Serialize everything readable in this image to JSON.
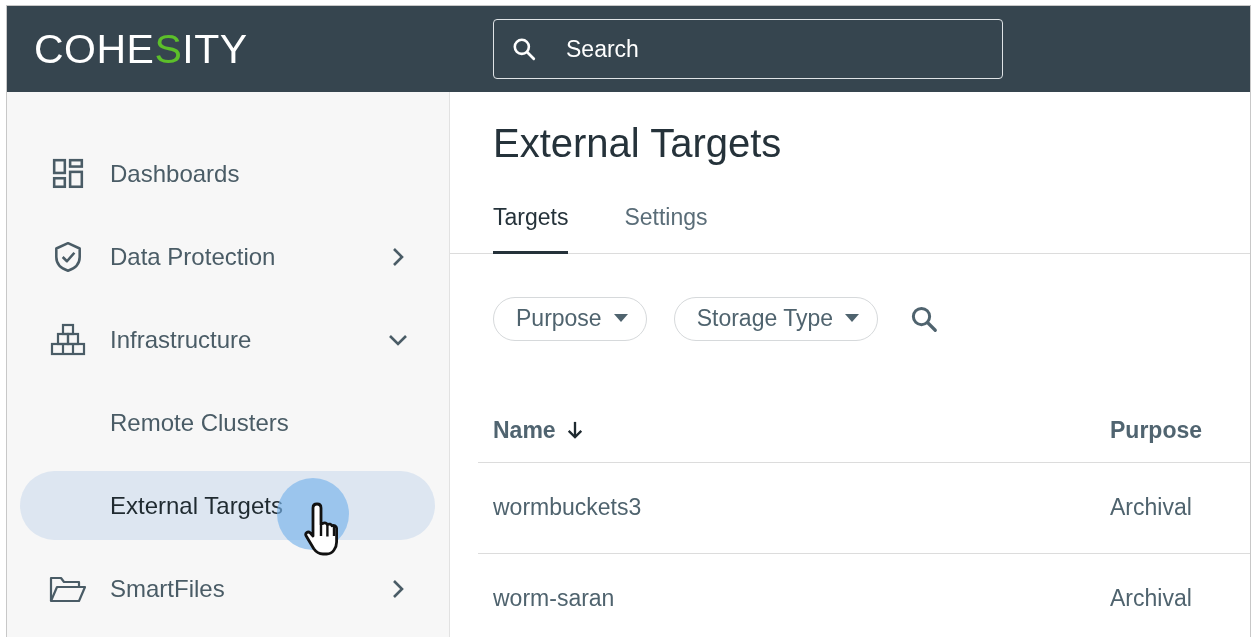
{
  "header": {
    "logo": [
      {
        "text": "COHE",
        "accent": false
      },
      {
        "text": "S",
        "accent": true
      },
      {
        "text": "ITY",
        "accent": false
      }
    ],
    "search": {
      "placeholder": "Search"
    }
  },
  "sidebar": {
    "items": [
      {
        "label": "Dashboards",
        "selected": false
      },
      {
        "label": "Data Protection",
        "selected": false,
        "expanded": false
      },
      {
        "label": "Infrastructure",
        "selected": false,
        "expanded": true,
        "children": [
          {
            "label": "Remote Clusters",
            "selected": false
          },
          {
            "label": "External Targets",
            "selected": true
          }
        ]
      },
      {
        "label": "SmartFiles",
        "selected": false,
        "expanded": false
      }
    ]
  },
  "page": {
    "title": "External Targets",
    "tabs": [
      {
        "label": "Targets",
        "selected": true
      },
      {
        "label": "Settings",
        "selected": false
      }
    ],
    "filters": [
      {
        "label": "Purpose"
      },
      {
        "label": "Storage Type"
      }
    ],
    "table": {
      "columns": [
        {
          "label": "Name",
          "sorted": true
        },
        {
          "label": "Purpose",
          "sorted": false
        }
      ],
      "rows": [
        [
          "wormbuckets3",
          "Archival"
        ],
        [
          "worm-saran",
          "Archival"
        ]
      ]
    }
  }
}
